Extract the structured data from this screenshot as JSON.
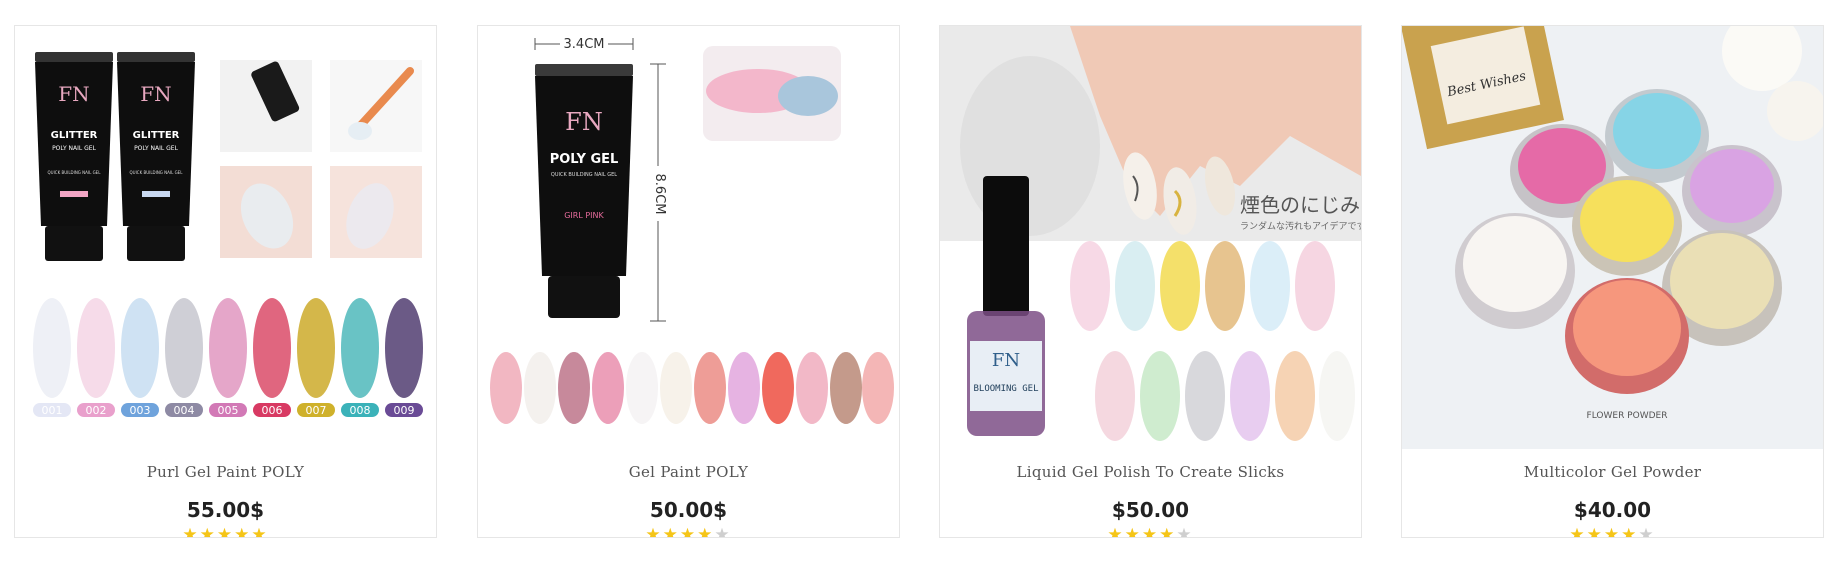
{
  "products": [
    {
      "title": "Purl Gel Paint POLY",
      "price": "55.00$",
      "rating": 5,
      "image_text": {
        "tube_brand": "FN",
        "tube_name": "GLITTER",
        "tube_sub": "POLY NAIL GEL",
        "tube_small": "QUICK BUILDING NAIL GEL",
        "swatches": [
          "001",
          "002",
          "003",
          "004",
          "005",
          "006",
          "007",
          "008",
          "009"
        ]
      }
    },
    {
      "title": "Gel Paint POLY",
      "price": "50.00$",
      "rating": 4,
      "image_text": {
        "width_label": "3.4CM",
        "height_label": "8.6CM",
        "tube_name": "POLY GEL",
        "tube_small": "QUICK BUILDING NAIL GEL",
        "tube_color": "GIRL PINK",
        "tube_brand": "FN"
      }
    },
    {
      "title": "Liquid Gel Polish To Create Slicks",
      "price": "$50.00",
      "rating": 4,
      "image_text": {
        "jp_title": "煙色のにじみ",
        "jp_sub": "ランダムな汚れもアイデアです",
        "bottle_brand": "FN",
        "bottle_label": "BLOOMING GEL"
      }
    },
    {
      "title": "Multicolor Gel Powder",
      "price": "$40.00",
      "rating": 4,
      "image_text": {
        "card_text": "Best Wishes",
        "jar_label": "FLOWER POWDER"
      }
    }
  ],
  "rating_max": 5,
  "colors": {
    "star_on": "#f5c518",
    "star_off": "#cfcfcf",
    "title": "#555555",
    "price": "#222222",
    "border": "#e6e6e6"
  },
  "icons": {
    "rating": "star-icon"
  }
}
